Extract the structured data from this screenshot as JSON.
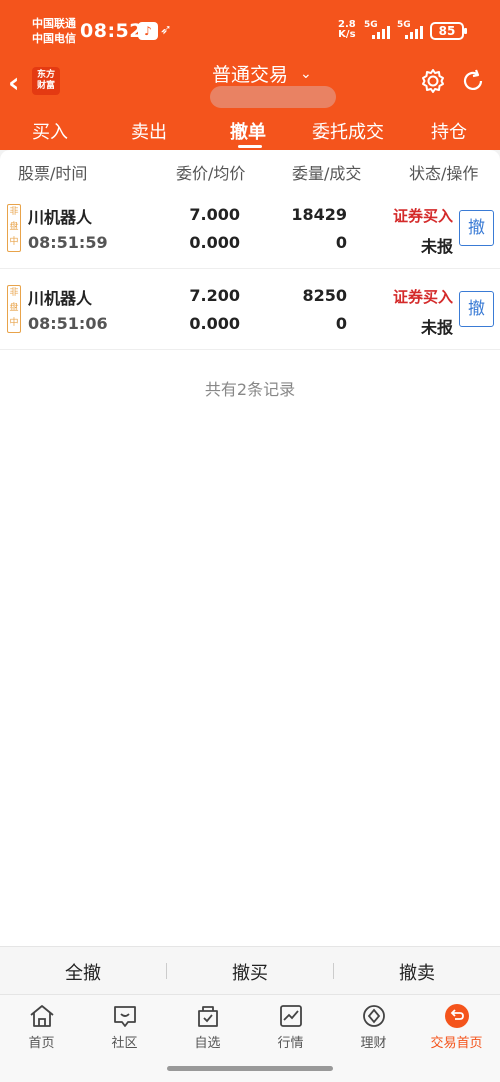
{
  "status_bar": {
    "carrier1": "中国联通",
    "carrier2": "中国电信",
    "time": "08:52",
    "net_speed": "2.8",
    "net_unit": "K/s",
    "signal1": "5G",
    "signal2": "5G",
    "battery": "85"
  },
  "header": {
    "logo_line1": "东方",
    "logo_line2": "财富",
    "title": "普通交易",
    "title_chevron": "⌄",
    "back_icon": "‹"
  },
  "tabs": [
    "买入",
    "卖出",
    "撤单",
    "委托成交",
    "持仓"
  ],
  "active_tab": "撤单",
  "columns": [
    "股票/时间",
    "委价/均价",
    "委量/成交",
    "状态/操作"
  ],
  "orders": [
    {
      "badge": [
        "非",
        "盘",
        "中"
      ],
      "name": "川机器人",
      "time": "08:51:59",
      "order_price": "7.000",
      "avg_price": "0.000",
      "order_qty": "18429",
      "filled_qty": "0",
      "type": "证券买入",
      "status": "未报",
      "action": "撤"
    },
    {
      "badge": [
        "非",
        "盘",
        "中"
      ],
      "name": "川机器人",
      "time": "08:51:06",
      "order_price": "7.200",
      "avg_price": "0.000",
      "order_qty": "8250",
      "filled_qty": "0",
      "type": "证券买入",
      "status": "未报",
      "action": "撤"
    }
  ],
  "records_note": "共有2条记录",
  "actions": [
    "全撤",
    "撤买",
    "撤卖"
  ],
  "bottom_nav": [
    {
      "label": "首页",
      "icon": "home-icon"
    },
    {
      "label": "社区",
      "icon": "community-icon"
    },
    {
      "label": "自选",
      "icon": "watchlist-icon"
    },
    {
      "label": "行情",
      "icon": "market-icon"
    },
    {
      "label": "理财",
      "icon": "finance-icon"
    },
    {
      "label": "交易首页",
      "icon": "trade-home-icon"
    }
  ],
  "colors": {
    "brand": "#f4541c",
    "buy": "#d42a2a",
    "link": "#3a7bd5",
    "badge": "#e8a34a"
  }
}
